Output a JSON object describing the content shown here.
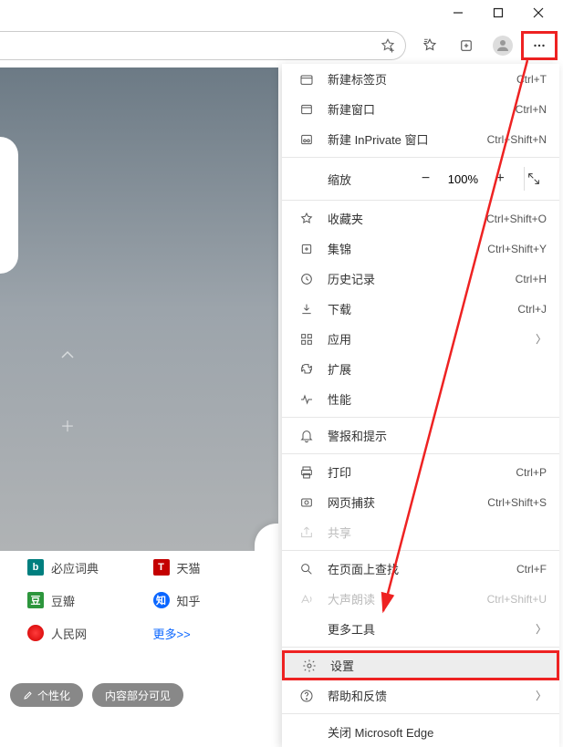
{
  "window": {
    "minimize": "−",
    "maximize": "▢",
    "close": "✕"
  },
  "menu": {
    "new_tab": {
      "label": "新建标签页",
      "shortcut": "Ctrl+T"
    },
    "new_window": {
      "label": "新建窗口",
      "shortcut": "Ctrl+N"
    },
    "new_inprivate": {
      "label": "新建 InPrivate 窗口",
      "shortcut": "Ctrl+Shift+N"
    },
    "zoom": {
      "label": "缩放",
      "minus": "−",
      "pct": "100%",
      "plus": "+",
      "fullscreen": "⤢"
    },
    "favorites": {
      "label": "收藏夹",
      "shortcut": "Ctrl+Shift+O"
    },
    "collections": {
      "label": "集锦",
      "shortcut": "Ctrl+Shift+Y"
    },
    "history": {
      "label": "历史记录",
      "shortcut": "Ctrl+H"
    },
    "downloads": {
      "label": "下载",
      "shortcut": "Ctrl+J"
    },
    "apps": {
      "label": "应用"
    },
    "extensions": {
      "label": "扩展"
    },
    "performance": {
      "label": "性能"
    },
    "alerts": {
      "label": "警报和提示"
    },
    "print": {
      "label": "打印",
      "shortcut": "Ctrl+P"
    },
    "web_capture": {
      "label": "网页捕获",
      "shortcut": "Ctrl+Shift+S"
    },
    "share": {
      "label": "共享"
    },
    "find": {
      "label": "在页面上查找",
      "shortcut": "Ctrl+F"
    },
    "read_aloud": {
      "label": "大声朗读",
      "shortcut": "Ctrl+Shift+U"
    },
    "more_tools": {
      "label": "更多工具"
    },
    "settings": {
      "label": "设置"
    },
    "help": {
      "label": "帮助和反馈"
    },
    "close_edge": {
      "label": "关闭 Microsoft Edge"
    }
  },
  "links": {
    "bing": "必应词典",
    "tmall": "天猫",
    "douban": "豆瓣",
    "zhihu": "知乎",
    "renmin": "人民网",
    "more": "更多>>"
  },
  "bottom": {
    "personalize": "个性化",
    "partial": "内容部分可见"
  },
  "badges": {
    "bing": "b",
    "tmall": "T",
    "douban": "豆",
    "zhihu": "知"
  }
}
